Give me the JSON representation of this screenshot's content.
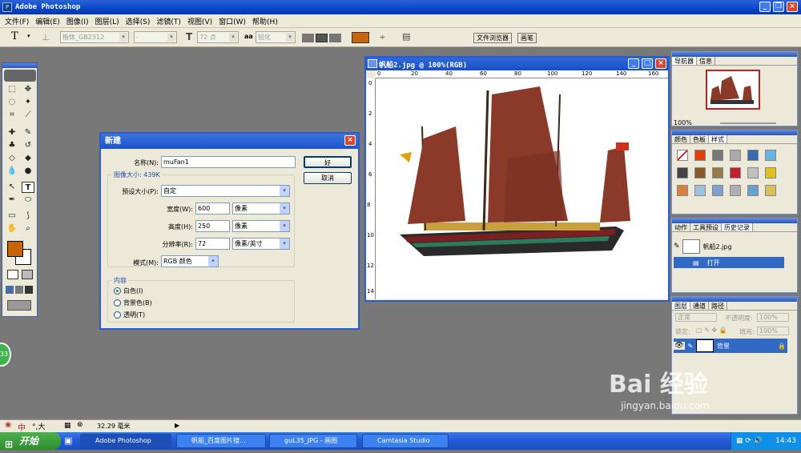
{
  "app": {
    "title": "Adobe Photoshop"
  },
  "menu": [
    "文件(F)",
    "编辑(E)",
    "图像(I)",
    "图层(L)",
    "选择(S)",
    "滤镜(T)",
    "视图(V)",
    "窗口(W)",
    "帮助(H)"
  ],
  "options": {
    "tool_glyph": "T",
    "font": "楷体_GB2312",
    "style": "-",
    "size": "72 点",
    "aa_label": "aa",
    "aa": "锐化",
    "color": "#c8650a",
    "tab1": "文件浏览器",
    "tab2": "画笔"
  },
  "document": {
    "title": "帆船2.jpg @ 100%(RGB)",
    "ruler_h": [
      "0",
      "20",
      "40",
      "60",
      "80",
      "100",
      "120",
      "140",
      "160"
    ],
    "ruler_v": [
      "0",
      "2",
      "4",
      "6",
      "8",
      "10",
      "12",
      "14"
    ]
  },
  "dialog": {
    "title": "新建",
    "name_label": "名称(N):",
    "name_value": "muFan1",
    "size_label": "图像大小: 439K",
    "preset_label": "预设大小(P):",
    "preset_value": "自定",
    "width_label": "宽度(W):",
    "width_value": "600",
    "width_unit": "像素",
    "height_label": "高度(H):",
    "height_value": "250",
    "height_unit": "像素",
    "res_label": "分辨率(R):",
    "res_value": "72",
    "res_unit": "像素/英寸",
    "mode_label": "模式(M):",
    "mode_value": "RGB 颜色",
    "content_label": "内容",
    "content_options": [
      "白色(I)",
      "背景色(B)",
      "透明(T)"
    ],
    "ok": "好",
    "cancel": "取消"
  },
  "navigator": {
    "tabs": [
      "导航器",
      "信息"
    ],
    "zoom": "100%"
  },
  "swatches": {
    "tabs": [
      "颜色",
      "色板",
      "样式"
    ]
  },
  "history": {
    "tabs": [
      "动作",
      "工具预设",
      "历史记录"
    ],
    "snapshot": "帆船2.jpg",
    "step": "打开"
  },
  "layers": {
    "tabs": [
      "图层",
      "通道",
      "路径"
    ],
    "blend": "正常",
    "opacity_label": "不透明度:",
    "opacity": "100%",
    "lock_label": "锁定:",
    "fill_label": "填充:",
    "fill": "100%",
    "layer_name": "背景"
  },
  "status": {
    "ime": "中",
    "ime_extra": "°,大",
    "measure": "32.29 毫米"
  },
  "side_badge": "33",
  "taskbar": {
    "start": "开始",
    "tasks": [
      "Adobe Photoshop",
      "帆船_百度图片搜...",
      "guL35_JPG - 画图",
      "Camtasia Studio"
    ],
    "time": "14:43"
  },
  "watermark": {
    "brand": "Bai 经验",
    "url": "jingyan.baidu.com"
  },
  "colors": {
    "foreground": "#c8650a",
    "titlebar": "#0a45c8",
    "workspace": "#787878"
  }
}
